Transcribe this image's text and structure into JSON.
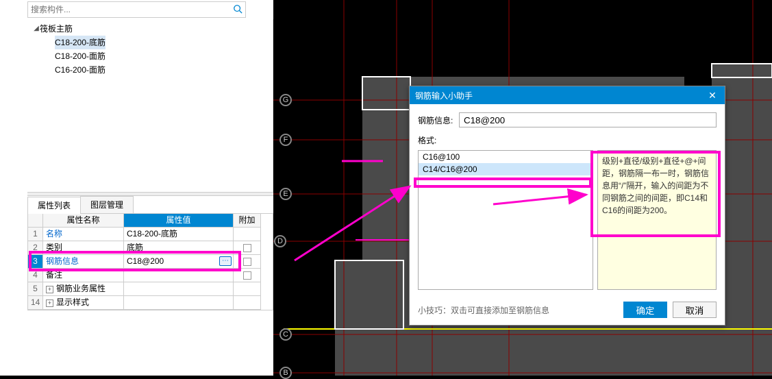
{
  "search": {
    "placeholder": "搜索构件..."
  },
  "tree": {
    "parent": "筏板主筋",
    "children": [
      "C18-200-底筋",
      "C18-200-面筋",
      "C16-200-面筋"
    ]
  },
  "tabs": {
    "props": "属性列表",
    "layers": "图层管理"
  },
  "grid": {
    "headers": {
      "name": "属性名称",
      "value": "属性值",
      "extra": "附加"
    },
    "rows": [
      {
        "n": "1",
        "name": "名称",
        "val": "C18-200-底筋"
      },
      {
        "n": "2",
        "name": "类别",
        "val": "底筋"
      },
      {
        "n": "3",
        "name": "钢筋信息",
        "val": "C18@200"
      },
      {
        "n": "4",
        "name": "备注",
        "val": ""
      },
      {
        "n": "5",
        "name": "钢筋业务属性",
        "val": ""
      },
      {
        "n": "14",
        "name": "显示样式",
        "val": ""
      }
    ]
  },
  "dialog": {
    "title": "钢筋输入小助手",
    "field_label": "钢筋信息:",
    "field_value": "C18@200",
    "format_label": "格式:",
    "items": [
      "C16@100",
      "C14/C16@200"
    ],
    "desc": "级别+直径/级别+直径+@+间距，钢筋隔一布一时，钢筋信息用“/”隔开，输入的间距为不同钢筋之间的间距，即C14和C16的间距为200。",
    "tip": "小技巧：双击可直接添加至钢筋信息",
    "ok": "确定",
    "cancel": "取消"
  },
  "axis_labels": [
    "G",
    "F",
    "E",
    "D",
    "C",
    "B"
  ]
}
